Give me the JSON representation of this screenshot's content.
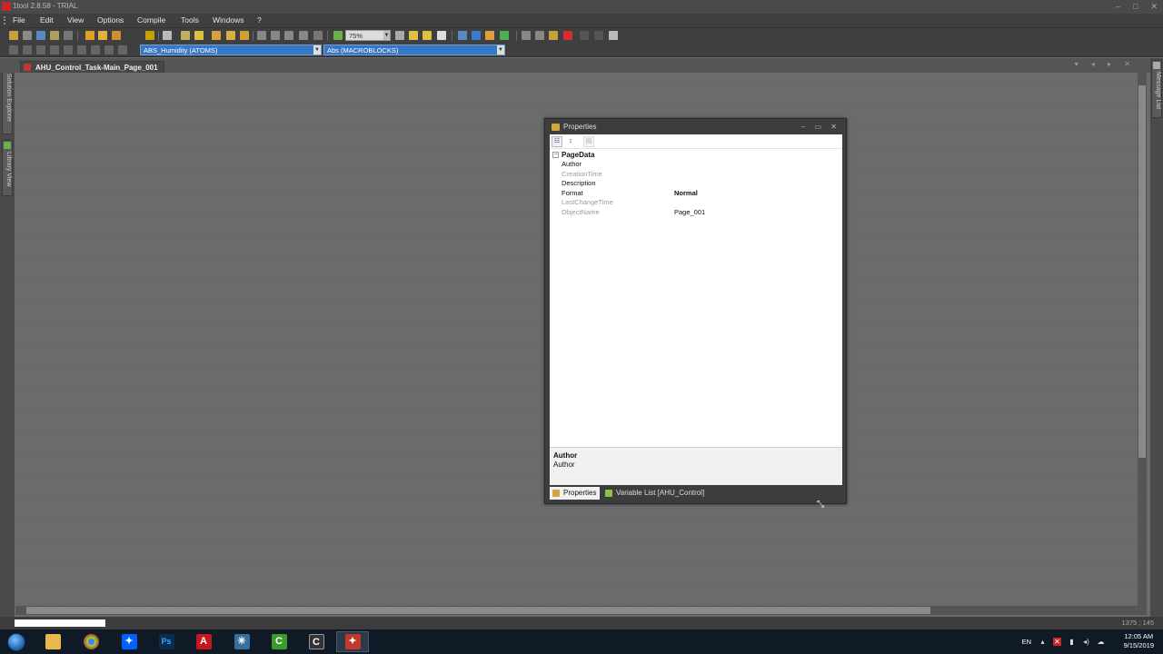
{
  "window": {
    "title": "1tool 2.8.58 - TRIAL",
    "min": "–",
    "max": "□",
    "close": "✕"
  },
  "menu": {
    "items": [
      {
        "label": "File"
      },
      {
        "label": "Edit"
      },
      {
        "label": "View"
      },
      {
        "label": "Options"
      },
      {
        "label": "Compile"
      },
      {
        "label": "Tools"
      },
      {
        "label": "Windows"
      },
      {
        "label": "?"
      }
    ]
  },
  "toolbar": {
    "zoom_value": "75%"
  },
  "toolbar2": {
    "object_combo": "ABS_Humidity (ATOMS)",
    "type_combo": "Abs (MACROBLOCKS)"
  },
  "document": {
    "tab_label": "AHU_Control_Task-Main_Page_001"
  },
  "side_panels": {
    "left": [
      {
        "label": "Solution Explorer"
      },
      {
        "label": "Library View"
      }
    ],
    "right": [
      {
        "label": "Message List"
      }
    ]
  },
  "properties": {
    "title": "Properties",
    "category": "PageData",
    "rows": [
      {
        "key": "Author",
        "value": "",
        "readonly": false,
        "bold": false
      },
      {
        "key": "CreationTime",
        "value": "",
        "readonly": true,
        "bold": false
      },
      {
        "key": "Description",
        "value": "",
        "readonly": false,
        "bold": false
      },
      {
        "key": "Format",
        "value": "Normal",
        "readonly": false,
        "bold": true
      },
      {
        "key": "LastChangeTime",
        "value": "",
        "readonly": true,
        "bold": false
      },
      {
        "key": "ObjectName",
        "value": "Page_001",
        "readonly": true,
        "bold": false
      }
    ],
    "description": {
      "title": "Author",
      "text": "Author"
    },
    "tabs": [
      {
        "label": "Properties",
        "active": true
      },
      {
        "label": "Variable List [AHU_Control]",
        "active": false
      }
    ]
  },
  "statusbar": {
    "coords": "1375 ; 145"
  },
  "taskbar": {
    "apps": [
      {
        "name": "file-explorer-icon",
        "glyph": "📁",
        "color": "#e8b84a"
      },
      {
        "name": "chrome-icon",
        "glyph": "●",
        "color": "#d93025"
      },
      {
        "name": "dropbox-icon",
        "glyph": "❖",
        "color": "#0061fe"
      },
      {
        "name": "photoshop-icon",
        "glyph": "Ps",
        "color": "#0a2c4e"
      },
      {
        "name": "autocad-icon",
        "glyph": "A",
        "color": "#c4161c"
      },
      {
        "name": "network-app-icon",
        "glyph": "✦",
        "color": "#3a6f9c"
      },
      {
        "name": "camtasia-icon",
        "glyph": "C",
        "color": "#3a9a2a"
      },
      {
        "name": "camtasia-recorder-icon",
        "glyph": "C",
        "color": "#333333"
      },
      {
        "name": "1tool-icon",
        "glyph": "✦",
        "color": "#c0392b"
      }
    ],
    "lang": "EN",
    "time": "12:05 AM",
    "date": "9/15/2019"
  }
}
